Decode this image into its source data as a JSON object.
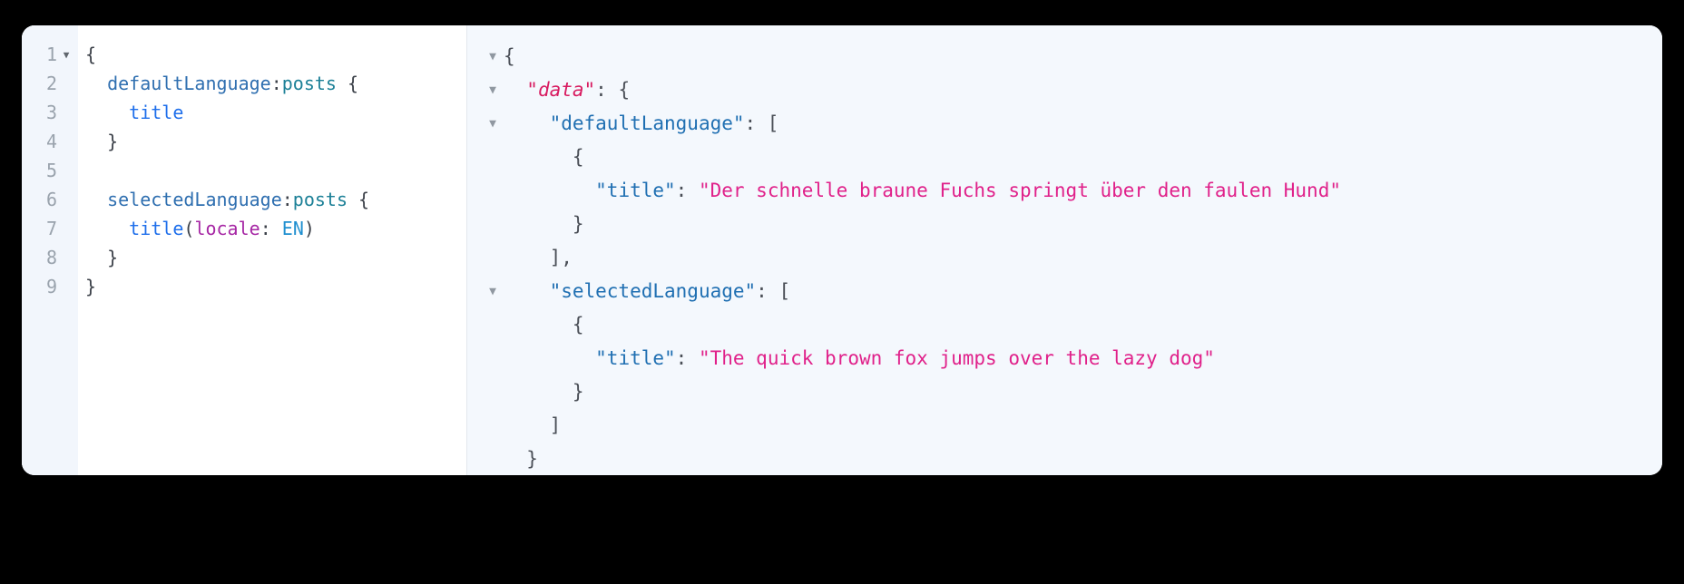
{
  "editor": {
    "query_pane": {
      "name": "graphql-query-editor",
      "gutter_numbers": [
        "1",
        "2",
        "3",
        "4",
        "5",
        "6",
        "7",
        "8",
        "9"
      ],
      "fold_markers": [
        "▼",
        "",
        "",
        "",
        "",
        "",
        "",
        "",
        ""
      ],
      "lines": [
        {
          "indent": 0,
          "tokens": [
            {
              "t": "{",
              "c": "tok-punct"
            }
          ]
        },
        {
          "indent": 1,
          "tokens": [
            {
              "t": "defaultLanguage",
              "c": "tok-alias"
            },
            {
              "t": ":",
              "c": "tok-punct"
            },
            {
              "t": "posts",
              "c": "tok-type"
            },
            {
              "t": " {",
              "c": "tok-punct"
            }
          ]
        },
        {
          "indent": 2,
          "tokens": [
            {
              "t": "title",
              "c": "tok-field"
            }
          ]
        },
        {
          "indent": 1,
          "tokens": [
            {
              "t": "}",
              "c": "tok-punct"
            }
          ]
        },
        {
          "indent": 0,
          "tokens": [
            {
              "t": "",
              "c": "tok-punct"
            }
          ]
        },
        {
          "indent": 1,
          "tokens": [
            {
              "t": "selectedLanguage",
              "c": "tok-alias"
            },
            {
              "t": ":",
              "c": "tok-punct"
            },
            {
              "t": "posts",
              "c": "tok-type"
            },
            {
              "t": " {",
              "c": "tok-punct"
            }
          ]
        },
        {
          "indent": 2,
          "tokens": [
            {
              "t": "title",
              "c": "tok-field"
            },
            {
              "t": "(",
              "c": "tok-punct"
            },
            {
              "t": "locale",
              "c": "tok-arg"
            },
            {
              "t": ": ",
              "c": "tok-punct"
            },
            {
              "t": "EN",
              "c": "tok-enum"
            },
            {
              "t": ")",
              "c": "tok-punct"
            }
          ]
        },
        {
          "indent": 1,
          "tokens": [
            {
              "t": "}",
              "c": "tok-punct"
            }
          ]
        },
        {
          "indent": 0,
          "tokens": [
            {
              "t": "}",
              "c": "tok-punct"
            }
          ]
        }
      ]
    },
    "result_pane": {
      "name": "graphql-result-viewer",
      "fold_open": [
        true,
        true,
        true,
        false,
        false,
        false,
        false,
        true,
        false,
        false,
        false,
        false,
        false,
        false
      ],
      "fold_glyph": "▼",
      "lines": [
        {
          "indent": 0,
          "tokens": [
            {
              "t": "{",
              "c": "j-punct"
            }
          ]
        },
        {
          "indent": 1,
          "tokens": [
            {
              "t": "\"data\"",
              "c": "j-key-hl"
            },
            {
              "t": ": {",
              "c": "j-punct"
            }
          ]
        },
        {
          "indent": 2,
          "tokens": [
            {
              "t": "\"defaultLanguage\"",
              "c": "j-key"
            },
            {
              "t": ": [",
              "c": "j-punct"
            }
          ]
        },
        {
          "indent": 3,
          "tokens": [
            {
              "t": "{",
              "c": "j-punct"
            }
          ]
        },
        {
          "indent": 4,
          "tokens": [
            {
              "t": "\"title\"",
              "c": "j-key"
            },
            {
              "t": ": ",
              "c": "j-punct"
            },
            {
              "t": "\"Der schnelle braune Fuchs springt über den faulen Hund\"",
              "c": "j-string"
            }
          ]
        },
        {
          "indent": 3,
          "tokens": [
            {
              "t": "}",
              "c": "j-punct"
            }
          ]
        },
        {
          "indent": 2,
          "tokens": [
            {
              "t": "],",
              "c": "j-punct"
            }
          ]
        },
        {
          "indent": 2,
          "tokens": [
            {
              "t": "\"selectedLanguage\"",
              "c": "j-key"
            },
            {
              "t": ": [",
              "c": "j-punct"
            }
          ]
        },
        {
          "indent": 3,
          "tokens": [
            {
              "t": "{",
              "c": "j-punct"
            }
          ]
        },
        {
          "indent": 4,
          "tokens": [
            {
              "t": "\"title\"",
              "c": "j-key"
            },
            {
              "t": ": ",
              "c": "j-punct"
            },
            {
              "t": "\"The quick brown fox jumps over the lazy dog\"",
              "c": "j-string"
            }
          ]
        },
        {
          "indent": 3,
          "tokens": [
            {
              "t": "}",
              "c": "j-punct"
            }
          ]
        },
        {
          "indent": 2,
          "tokens": [
            {
              "t": "]",
              "c": "j-punct"
            }
          ]
        },
        {
          "indent": 1,
          "tokens": [
            {
              "t": "}",
              "c": "j-punct"
            }
          ]
        },
        {
          "indent": 0,
          "tokens": [
            {
              "t": "}",
              "c": "j-punct"
            }
          ],
          "caret": true
        }
      ]
    }
  },
  "colors": {
    "background": "#000000",
    "card": "#ffffff",
    "gutter": "#f2f6fc",
    "result_bg": "#f4f8fd",
    "string": "#e0218a",
    "key": "#1f6fb2",
    "data_key": "#d81b60",
    "field": "#1f6feb",
    "type": "#1c8097",
    "argument": "#a626a4",
    "enum": "#1f8fd0",
    "line_number": "#9aa3ad"
  }
}
